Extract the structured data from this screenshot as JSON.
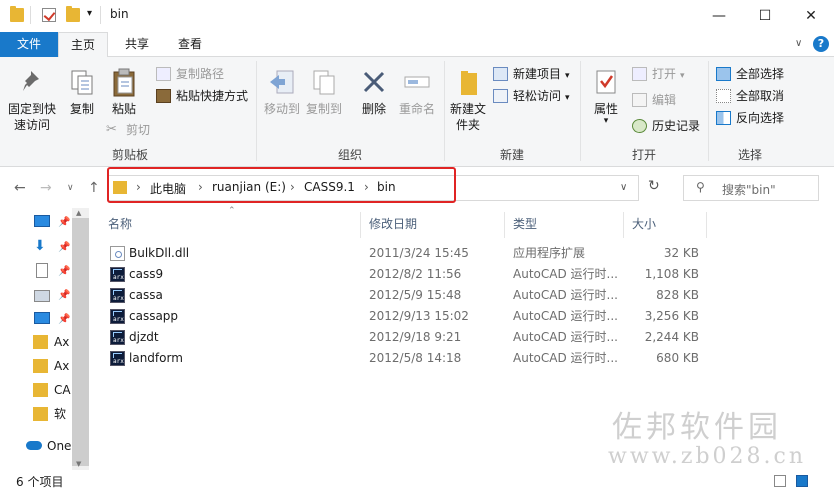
{
  "window": {
    "title": "bin",
    "controls": {
      "minimize": "—",
      "maximize": "☐",
      "close": "✕"
    }
  },
  "tabs": {
    "file": "文件",
    "home": "主页",
    "share": "共享",
    "view": "查看"
  },
  "ribbon": {
    "clipboard": {
      "label": "剪贴板",
      "pin": "固定到快速访问",
      "copy": "复制",
      "paste": "粘贴",
      "copy_path": "复制路径",
      "paste_shortcut": "粘贴快捷方式",
      "cut": "剪切"
    },
    "organize": {
      "label": "组织",
      "move_to": "移动到",
      "copy_to": "复制到",
      "delete": "删除",
      "rename": "重命名"
    },
    "new": {
      "label": "新建",
      "new_folder": "新建文件夹",
      "new_item": "新建项目",
      "easy_access": "轻松访问"
    },
    "open": {
      "label": "打开",
      "properties": "属性",
      "open": "打开",
      "edit": "编辑",
      "history": "历史记录"
    },
    "select": {
      "label": "选择",
      "select_all": "全部选择",
      "select_none": "全部取消",
      "invert": "反向选择"
    }
  },
  "address": {
    "crumbs": [
      "此电脑",
      "ruanjian (E:)",
      "CASS9.1",
      "bin"
    ],
    "sep": "›",
    "search_placeholder": "搜索\"bin\""
  },
  "navpane": {
    "items": [
      "Ax",
      "Ax",
      "CA",
      "软",
      "One"
    ]
  },
  "columns": {
    "name": "名称",
    "modified": "修改日期",
    "type": "类型",
    "size": "大小"
  },
  "files": [
    {
      "name": "BulkDll.dll",
      "modified": "2011/3/24 15:45",
      "type": "应用程序扩展",
      "size": "32 KB",
      "icon": "dll-file-icon"
    },
    {
      "name": "cass9",
      "modified": "2012/8/2 11:56",
      "type": "AutoCAD 运行时...",
      "size": "1,108 KB",
      "icon": "arx-file-icon"
    },
    {
      "name": "cassa",
      "modified": "2012/5/9 15:48",
      "type": "AutoCAD 运行时...",
      "size": "828 KB",
      "icon": "arx-file-icon"
    },
    {
      "name": "cassapp",
      "modified": "2012/9/13 15:02",
      "type": "AutoCAD 运行时...",
      "size": "3,256 KB",
      "icon": "arx-file-icon"
    },
    {
      "name": "djzdt",
      "modified": "2012/9/18 9:21",
      "type": "AutoCAD 运行时...",
      "size": "2,244 KB",
      "icon": "arx-file-icon"
    },
    {
      "name": "landform",
      "modified": "2012/5/8 14:18",
      "type": "AutoCAD 运行时...",
      "size": "680 KB",
      "icon": "arx-file-icon"
    }
  ],
  "status": {
    "count": "6 个项目"
  },
  "watermark": {
    "line1": "佐邦软件园",
    "line2": "www.zb028.cn"
  },
  "colors": {
    "accent": "#1979ca",
    "highlight": "#e02424",
    "folder": "#e8b634"
  }
}
